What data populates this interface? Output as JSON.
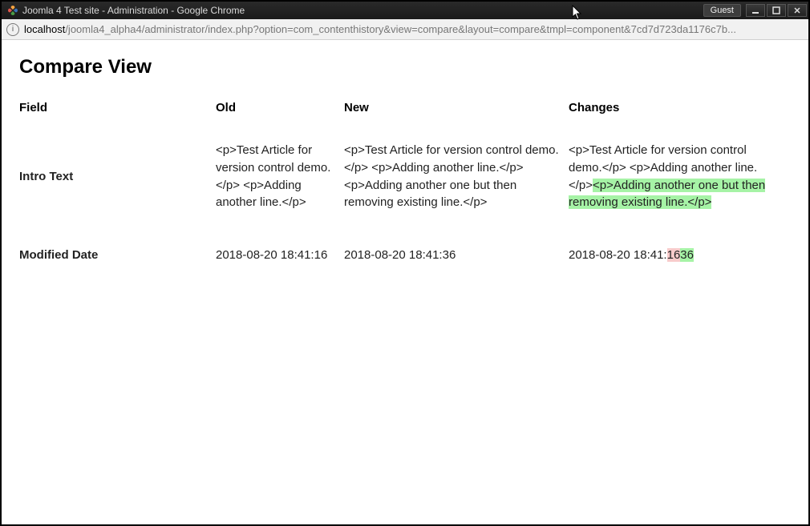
{
  "window": {
    "title": "Joomla 4 Test site - Administration - Google Chrome",
    "guest_label": "Guest"
  },
  "url": {
    "host": "localhost",
    "path": "/joomla4_alpha4/administrator/index.php?option=com_contenthistory&view=compare&layout=compare&tmpl=component&7cd7d723da1176c7b..."
  },
  "page": {
    "heading": "Compare View",
    "columns": {
      "field": "Field",
      "old": "Old",
      "new": "New",
      "changes": "Changes"
    },
    "rows": {
      "intro_text": {
        "label": "Intro Text",
        "old": "<p>Test Article for version control demo.</p> <p>Adding another line.</p>",
        "new": "<p>Test Article for version control demo.</p> <p>Adding another line.</p> <p>Adding another one but then removing existing line.</p>",
        "changes": {
          "unchanged_prefix": " <p>Test Article for version control demo.</p> <p>Adding another line.</p>",
          "added": "<p>Adding another one but then removing existing line.</p>"
        }
      },
      "modified_date": {
        "label": "Modified Date",
        "old": "2018-08-20 18:41:16",
        "new": "2018-08-20 18:41:36",
        "changes": {
          "prefix": " 2018-08-20 18:41:",
          "deleted": "16",
          "added": "36"
        }
      }
    }
  }
}
